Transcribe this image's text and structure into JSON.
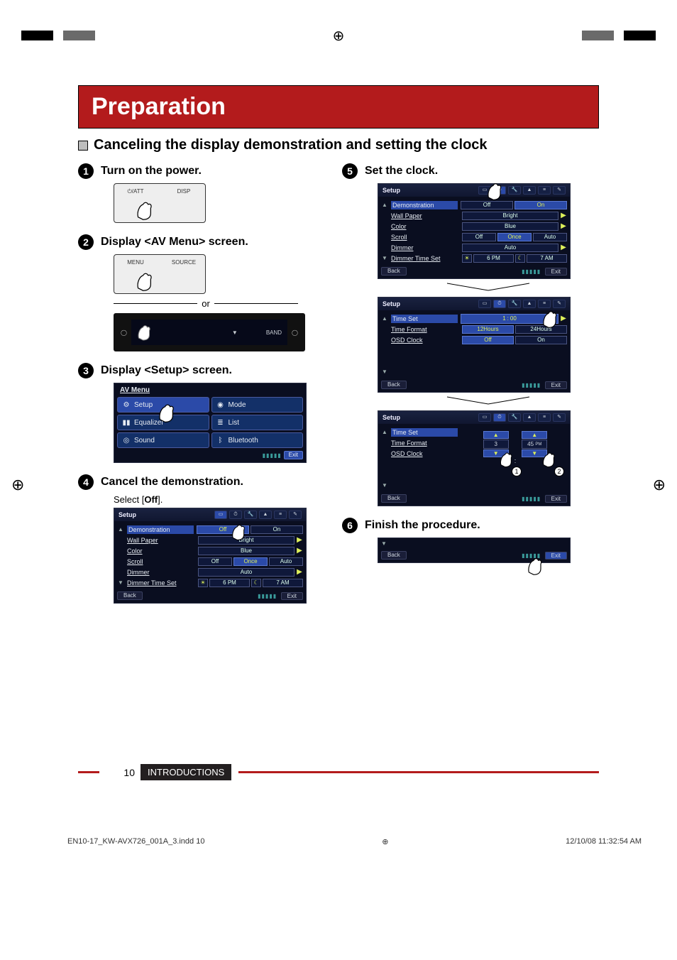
{
  "meta": {
    "title": "Preparation",
    "subheading": "Canceling the display demonstration and setting the clock",
    "page_number": "10",
    "section_label": "INTRODUCTIONS",
    "indd_file": "EN10-17_KW-AVX726_001A_3.indd   10",
    "indd_time": "12/10/08   11:32:54 AM"
  },
  "steps": {
    "s1": {
      "num": "1",
      "title": "Turn on the power."
    },
    "s2": {
      "num": "2",
      "title": "Display <AV Menu> screen.",
      "or": "or",
      "band": "BAND"
    },
    "s3": {
      "num": "3",
      "title": "Display <Setup> screen."
    },
    "s4": {
      "num": "4",
      "title": "Cancel the demonstration.",
      "sub": "Select [Off].",
      "sub_prefix": "Select [",
      "sub_bold": "Off",
      "sub_suffix": "]."
    },
    "s5": {
      "num": "5",
      "title": "Set the clock."
    },
    "s6": {
      "num": "6",
      "title": "Finish the procedure."
    }
  },
  "device_buttons": {
    "att": "⏻/ATT",
    "disp": "DISP",
    "menu": "MENU",
    "source": "SOURCE"
  },
  "avmenu": {
    "header": "AV Menu",
    "cells": {
      "setup": "Setup",
      "mode": "Mode",
      "equalizer": "Equalizer",
      "list": "List",
      "sound": "Sound",
      "bluetooth": "Bluetooth"
    },
    "exit": "Exit"
  },
  "setup_panel": {
    "header": "Setup",
    "rows": {
      "demonstration": "Demonstration",
      "wallpaper": "Wall Paper",
      "color": "Color",
      "scroll": "Scroll",
      "dimmer": "Dimmer",
      "dimmer_time_set": "Dimmer Time Set"
    },
    "values": {
      "off": "Off",
      "on": "On",
      "bright": "Bright",
      "blue": "Blue",
      "once": "Once",
      "auto": "Auto",
      "pm6": "6 PM",
      "am7": "7 AM"
    },
    "back": "Back",
    "exit": "Exit"
  },
  "clock_panel1": {
    "header": "Setup",
    "rows": {
      "time_set": "Time Set",
      "time_format": "Time Format",
      "osd_clock": "OSD Clock"
    },
    "values": {
      "time_set_h": "1",
      "time_set_m": "00",
      "h12": "12Hours",
      "h24": "24Hours",
      "off": "Off",
      "on": "On"
    },
    "back": "Back",
    "exit": "Exit"
  },
  "clock_panel2": {
    "header": "Setup",
    "rows": {
      "time_set": "Time Set",
      "time_format": "Time Format",
      "osd_clock": "OSD Clock"
    },
    "spinner": {
      "hour": "3",
      "minute": "45",
      "ampm": "PM"
    },
    "back": "Back",
    "exit": "Exit",
    "callout1": "1",
    "callout2": "2"
  },
  "finish_panel": {
    "back": "Back",
    "exit": "Exit"
  }
}
